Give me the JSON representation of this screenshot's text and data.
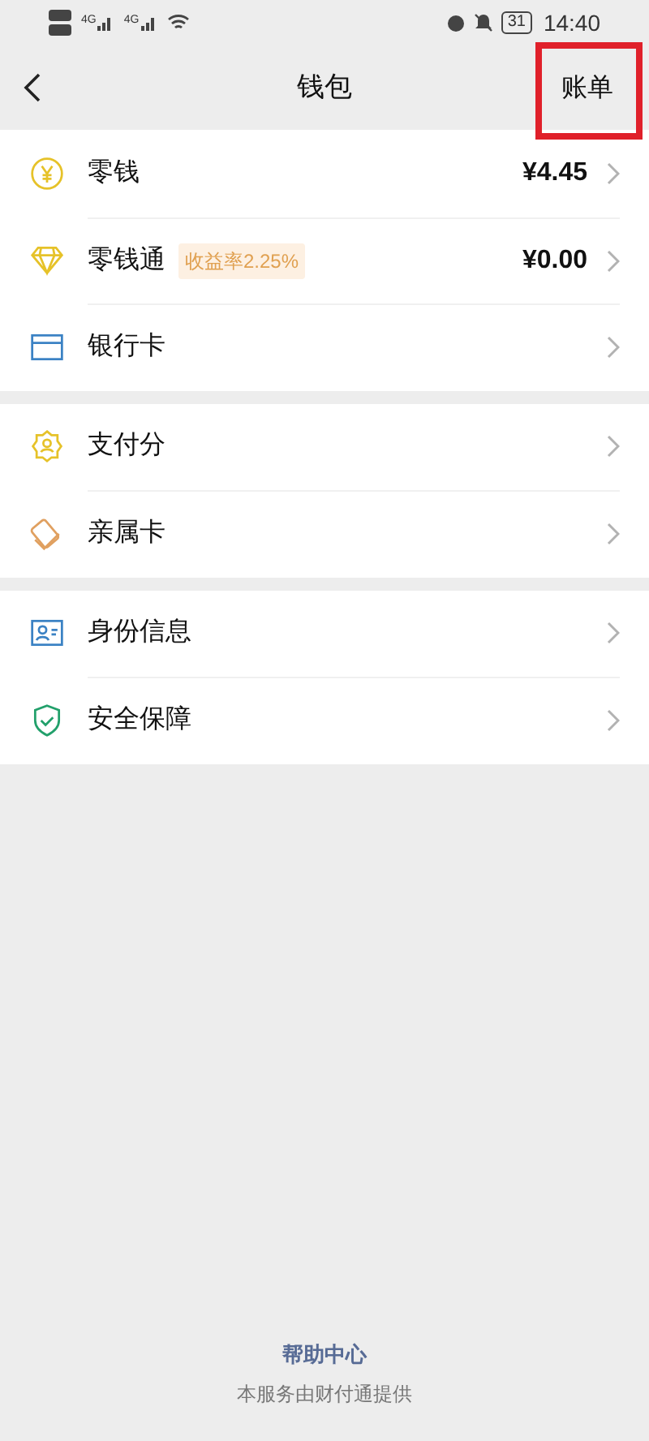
{
  "status_bar": {
    "networks": [
      "4G",
      "4G"
    ],
    "battery": "31",
    "time": "14:40"
  },
  "header": {
    "title": "钱包",
    "action": "账单",
    "action_highlighted": true
  },
  "sections": [
    {
      "items": [
        {
          "label": "零钱",
          "value": "¥4.45"
        },
        {
          "label": "零钱通",
          "badge": "收益率2.25%",
          "value": "¥0.00"
        },
        {
          "label": "银行卡"
        }
      ]
    },
    {
      "items": [
        {
          "label": "支付分"
        },
        {
          "label": "亲属卡"
        }
      ]
    },
    {
      "items": [
        {
          "label": "身份信息"
        },
        {
          "label": "安全保障"
        }
      ]
    }
  ],
  "footer": {
    "link": "帮助中心",
    "note": "本服务由财付通提供"
  }
}
